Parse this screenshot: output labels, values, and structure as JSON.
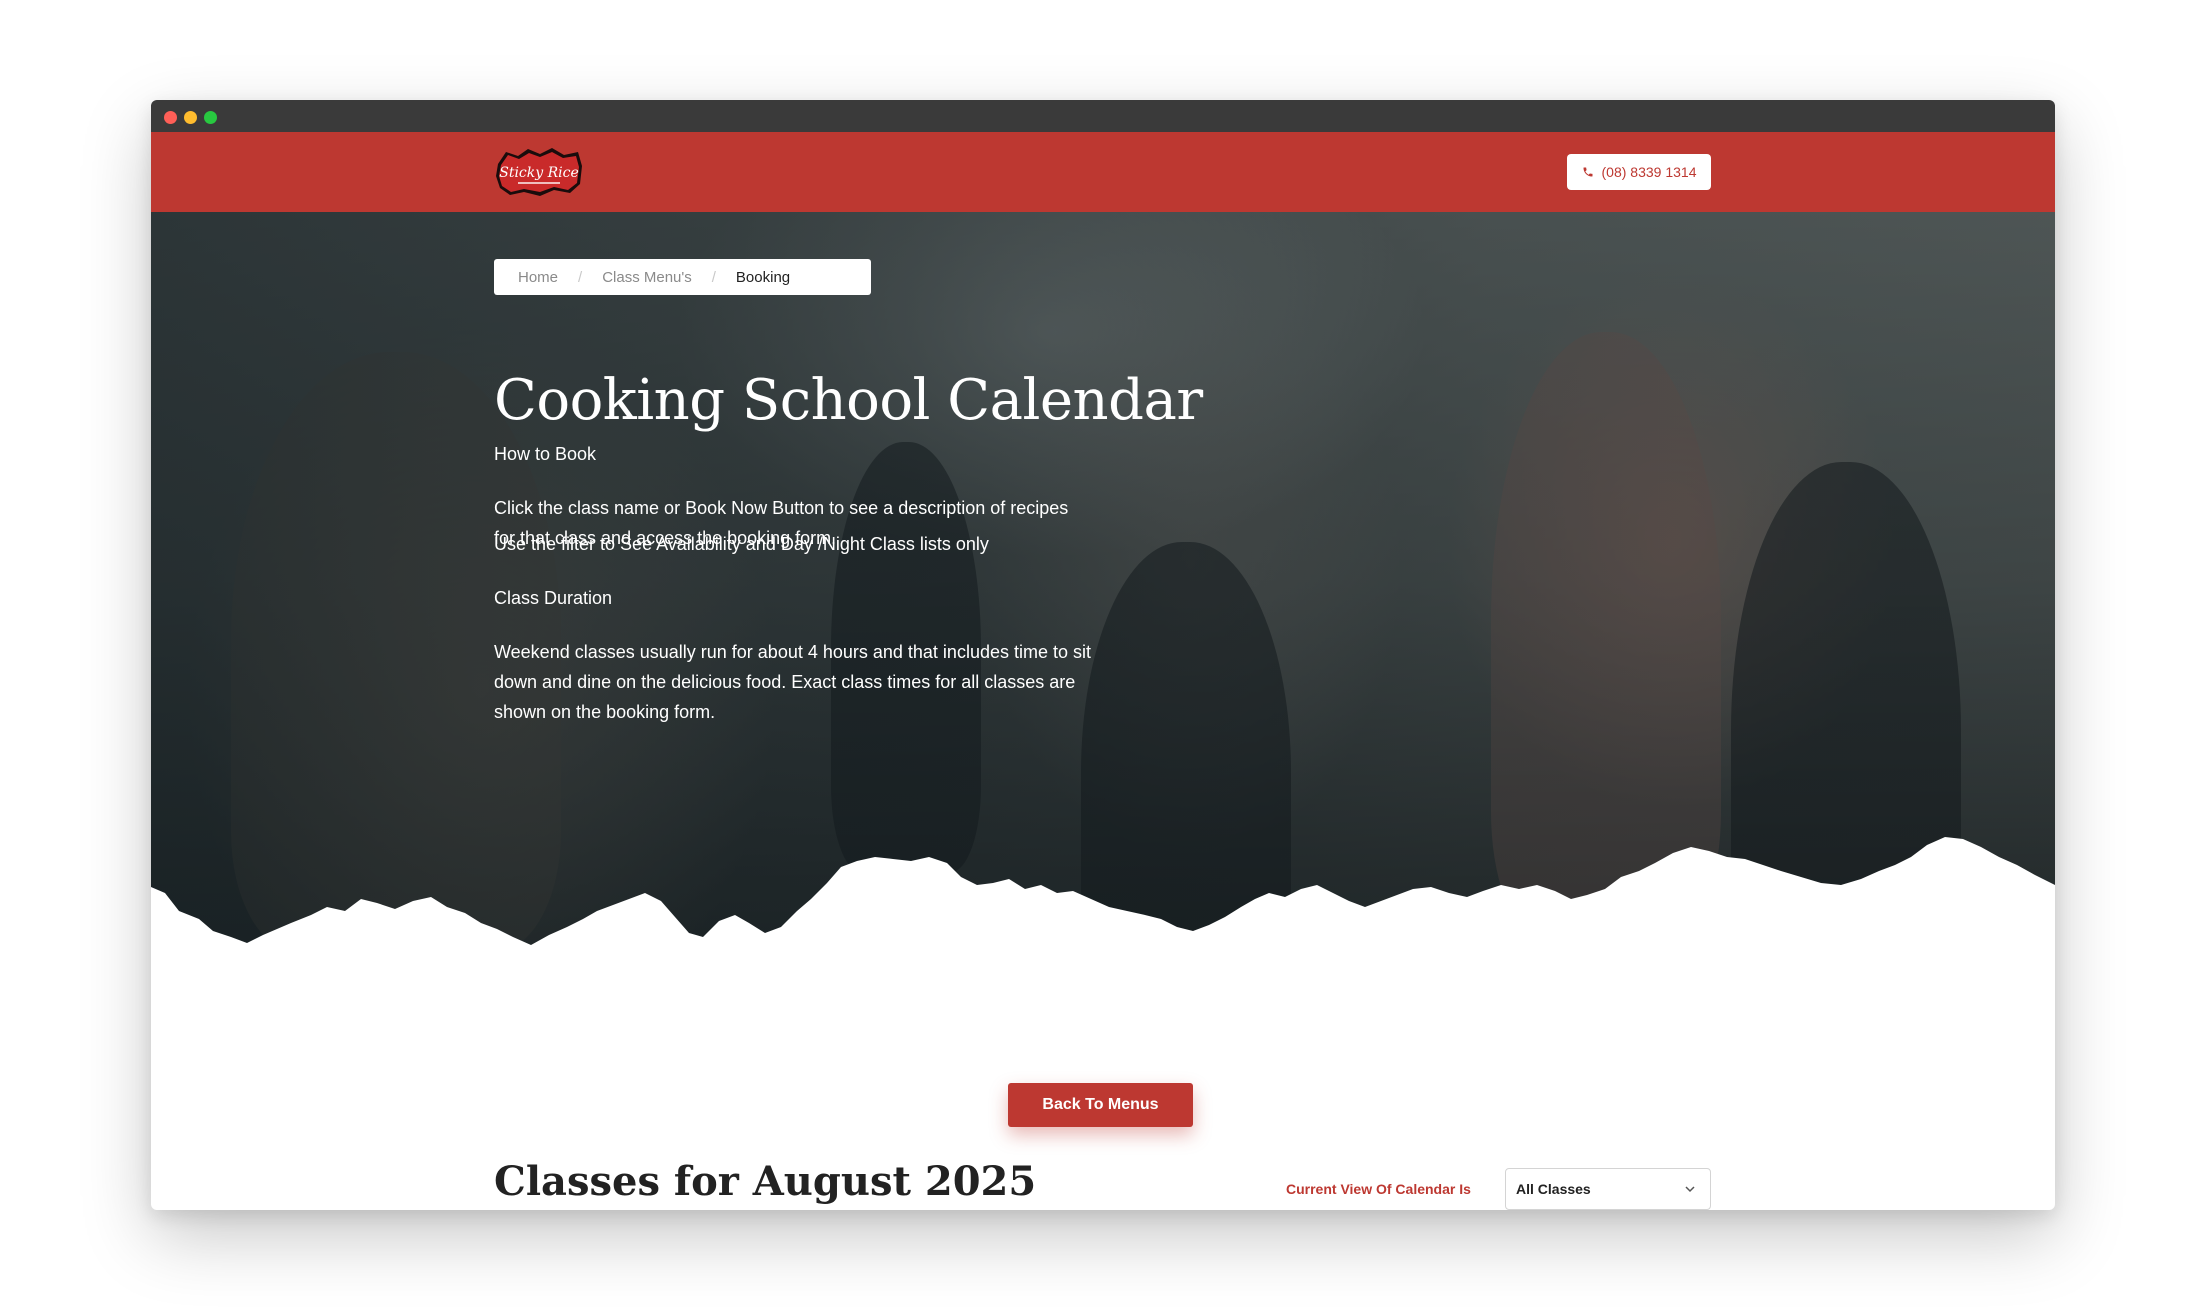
{
  "window": {
    "controls": [
      "close",
      "minimize",
      "maximize"
    ]
  },
  "header": {
    "logo_text": "Sticky Rice",
    "phone": "(08) 8339 1314",
    "brand_color": "#bd3831"
  },
  "breadcrumb": {
    "items": [
      "Home",
      "Class Menu's",
      "Booking"
    ],
    "separator": "/"
  },
  "hero": {
    "title": "Cooking School Calendar",
    "how_to_book_heading": "How to Book",
    "how_to_book_text": "Click the class name or Book Now Button to see a description of recipes for that class and access the booking form.",
    "filter_text": "Use the filter to See Availability and Day /Night Class lists only",
    "duration_heading": "Class Duration",
    "duration_text": "Weekend classes usually run for about 4 hours and that includes time to sit down and dine on the delicious food. Exact class times for all classes are shown on the booking form."
  },
  "main": {
    "back_button": "Back To Menus",
    "classes_title": "Classes for August 2025",
    "view_label": "Current View Of Calendar Is",
    "view_selected": "All Classes"
  },
  "icons": {
    "phone": "phone-icon",
    "select": "chevron-down-icon"
  }
}
